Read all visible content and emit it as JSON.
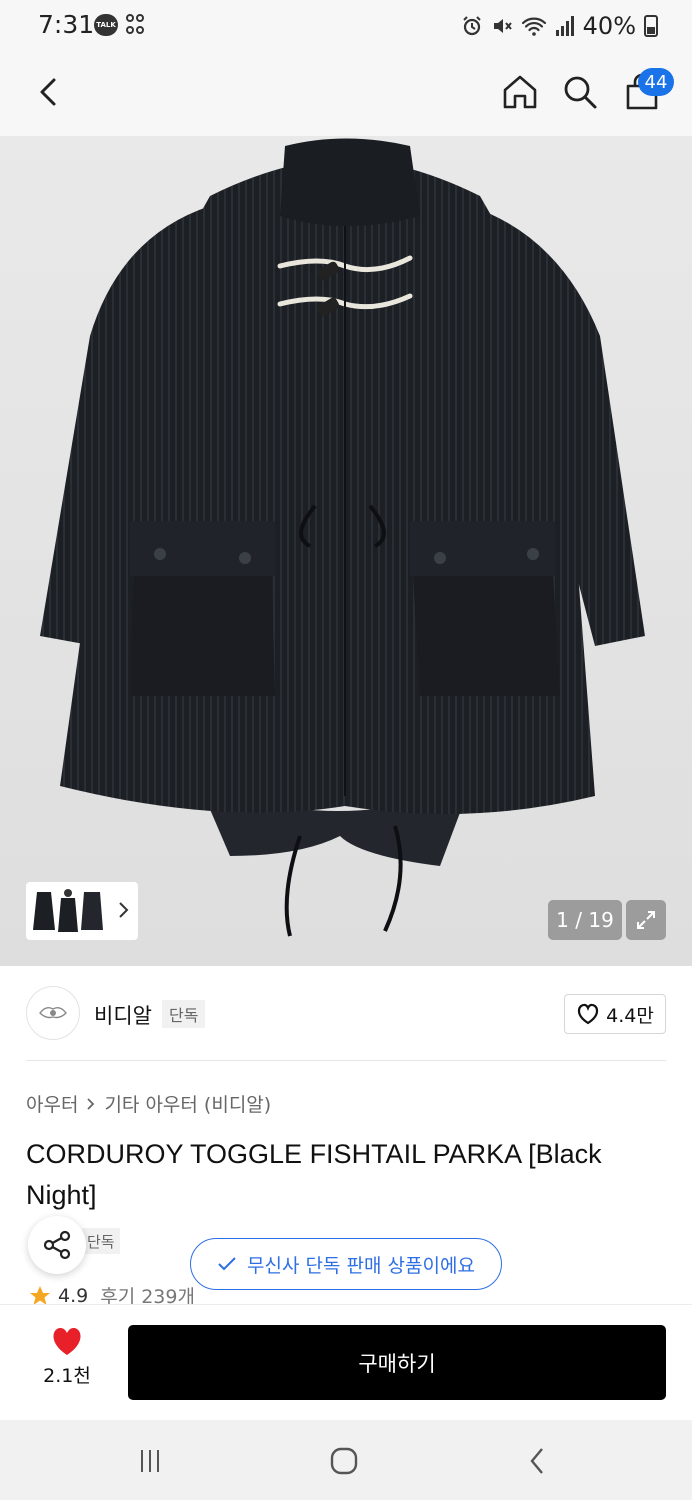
{
  "status_bar": {
    "time": "7:31",
    "talk_label": "TALK",
    "battery": "40%",
    "icons": [
      "kakaotalk-icon",
      "app-grid-icon",
      "alarm-icon",
      "mute-icon",
      "wifi-icon",
      "signal-icon",
      "battery-icon"
    ]
  },
  "top_nav": {
    "back_icon": "chevron-left-icon",
    "home_icon": "home-icon",
    "search_icon": "search-icon",
    "cart_icon": "shopping-bag-icon",
    "cart_count": "44"
  },
  "gallery": {
    "counter": "1 / 19",
    "expand_icon": "expand-icon",
    "thumb_chevron": "chevron-right-icon"
  },
  "brand": {
    "name": "비디알",
    "tag": "단독",
    "like_count": "4.4만"
  },
  "product": {
    "breadcrumb": [
      "아우터",
      "기타 아우터 (비디알)"
    ],
    "title": "CORDUROY TOGGLE FISHTAIL PARKA [Black Night]",
    "exclusive_tag": "단독",
    "rating": "4.9",
    "reviews": "후기 239개"
  },
  "toast": {
    "message": "무신사 단독 판매 상품이에요"
  },
  "bottom": {
    "wish_count": "2.1천",
    "buy_label": "구매하기"
  },
  "colors": {
    "accent_blue": "#2f6fe4",
    "badge_blue": "#1a73e8",
    "heart_red": "#e8202a",
    "star": "#f5a623",
    "buy_bg": "#000000"
  }
}
